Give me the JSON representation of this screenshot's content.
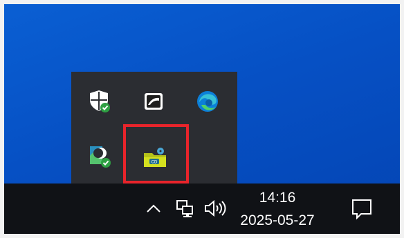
{
  "overflow": {
    "icons": [
      {
        "name": "windows-security-icon"
      },
      {
        "name": "app-tray-icon"
      },
      {
        "name": "microsoft-edge-icon"
      },
      {
        "name": "cloud-sync-app-icon"
      },
      {
        "name": "cd-folder-app-icon",
        "highlighted": true
      }
    ]
  },
  "taskbar": {
    "time": "14:16",
    "date": "2025-05-27"
  },
  "colors": {
    "desktop": "#0650c4",
    "panel": "#2b2d32",
    "taskbar": "#101216",
    "highlight": "#e8242b"
  }
}
